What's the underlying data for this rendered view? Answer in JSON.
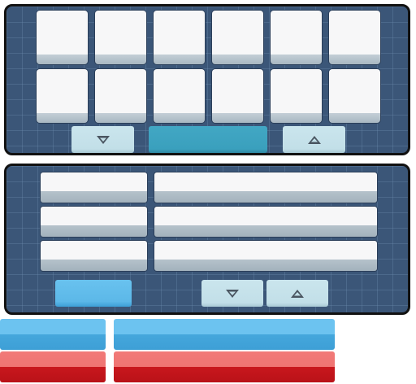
{
  "colors": {
    "panel_background": "#3b5678",
    "panel_border": "#111111",
    "tile_face": "#f7f7f8",
    "tile_shadow": "#a8b7c2",
    "arrow_button": "#c2dfe8",
    "arrow_glyph": "#4a5560",
    "teal_bar": "#3aa0bd",
    "blue_button": "#5cb8e8",
    "strip_blue": "#44a7dc",
    "strip_red": "#c9171d"
  },
  "top_panel": {
    "grid_rows": 2,
    "grid_columns": 6,
    "scroll_down_icon": "triangle-down-icon",
    "scroll_up_icon": "triangle-up-icon"
  },
  "bottom_panel": {
    "list_rows": 3,
    "list_columns": 2,
    "scroll_down_icon": "triangle-down-icon",
    "scroll_up_icon": "triangle-up-icon"
  }
}
